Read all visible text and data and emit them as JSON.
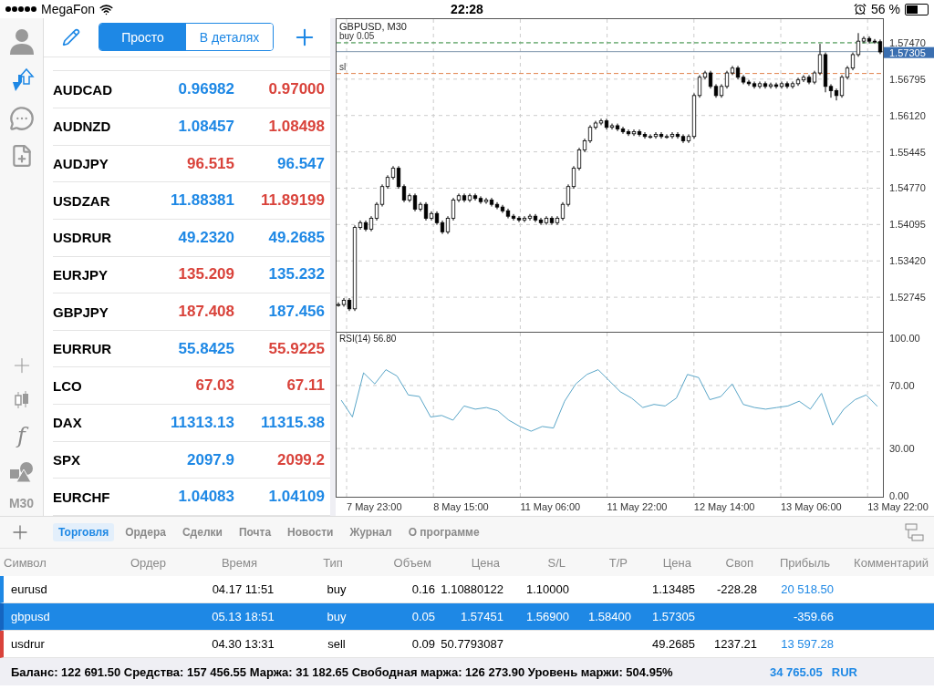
{
  "status_bar": {
    "carrier": "MegaFon",
    "time": "22:28",
    "battery": "56 %"
  },
  "sidebar": {
    "indicator_symbol": "f",
    "timeframe": "M30"
  },
  "quotes": {
    "modes": [
      {
        "label": "Просто",
        "selected": true
      },
      {
        "label": "В деталях",
        "selected": false
      }
    ],
    "rows": [
      {
        "symbol": "AUDCAD",
        "bid": {
          "value": "0.96982",
          "color": "#1e88e5"
        },
        "ask": {
          "value": "0.97000",
          "color": "#d9433b"
        }
      },
      {
        "symbol": "AUDNZD",
        "bid": {
          "value": "1.08457",
          "color": "#1e88e5"
        },
        "ask": {
          "value": "1.08498",
          "color": "#d9433b"
        }
      },
      {
        "symbol": "AUDJPY",
        "bid": {
          "value": "96.515",
          "color": "#d9433b"
        },
        "ask": {
          "value": "96.547",
          "color": "#1e88e5"
        }
      },
      {
        "symbol": "USDZAR",
        "bid": {
          "value": "11.88381",
          "color": "#1e88e5"
        },
        "ask": {
          "value": "11.89199",
          "color": "#d9433b"
        }
      },
      {
        "symbol": "USDRUR",
        "bid": {
          "value": "49.2320",
          "color": "#1e88e5"
        },
        "ask": {
          "value": "49.2685",
          "color": "#1e88e5"
        }
      },
      {
        "symbol": "EURJPY",
        "bid": {
          "value": "135.209",
          "color": "#d9433b"
        },
        "ask": {
          "value": "135.232",
          "color": "#1e88e5"
        }
      },
      {
        "symbol": "GBPJPY",
        "bid": {
          "value": "187.408",
          "color": "#d9433b"
        },
        "ask": {
          "value": "187.456",
          "color": "#1e88e5"
        }
      },
      {
        "symbol": "EURRUR",
        "bid": {
          "value": "55.8425",
          "color": "#1e88e5"
        },
        "ask": {
          "value": "55.9225",
          "color": "#d9433b"
        }
      },
      {
        "symbol": "LCO",
        "bid": {
          "value": "67.03",
          "color": "#d9433b"
        },
        "ask": {
          "value": "67.11",
          "color": "#d9433b"
        }
      },
      {
        "symbol": "DAX",
        "bid": {
          "value": "11313.13",
          "color": "#1e88e5"
        },
        "ask": {
          "value": "11315.38",
          "color": "#1e88e5"
        }
      },
      {
        "symbol": "SPX",
        "bid": {
          "value": "2097.9",
          "color": "#1e88e5"
        },
        "ask": {
          "value": "2099.2",
          "color": "#d9433b"
        }
      },
      {
        "symbol": "EURCHF",
        "bid": {
          "value": "1.04083",
          "color": "#1e88e5"
        },
        "ask": {
          "value": "1.04109",
          "color": "#1e88e5"
        }
      }
    ]
  },
  "chart": {
    "chart_data": {
      "type": "candlestick",
      "title": "GBPUSD, M30",
      "grid": true,
      "ylim": [
        1.52104,
        1.57892
      ],
      "yticks": [
        {
          "value": 1.5747,
          "label": "1.57470"
        },
        {
          "value": 1.56795,
          "label": "1.56795"
        },
        {
          "value": 1.5612,
          "label": "1.56120"
        },
        {
          "value": 1.55445,
          "label": "1.55445"
        },
        {
          "value": 1.5477,
          "label": "1.54770"
        },
        {
          "value": 1.54095,
          "label": "1.54095"
        },
        {
          "value": 1.5342,
          "label": "1.53420"
        },
        {
          "value": 1.52745,
          "label": "1.52745"
        }
      ],
      "ref_lines": [
        {
          "axis": "y",
          "value": 1.5747,
          "label": "buy 0.05",
          "color": "#3f9a4a"
        },
        {
          "axis": "y",
          "value": 1.57305,
          "label": "1.57305",
          "color": "#7f96ad"
        },
        {
          "axis": "y",
          "value": 1.569,
          "label": "sl",
          "color": "#e0804a"
        }
      ],
      "categories": [
        null,
        null,
        null,
        null,
        null,
        null,
        null,
        null,
        null,
        null,
        null,
        null,
        null,
        null,
        null,
        null,
        null,
        null,
        null,
        null,
        null,
        null,
        null,
        null,
        null,
        null,
        null,
        null,
        null,
        null,
        null,
        null,
        null,
        null,
        null,
        null,
        null,
        null,
        null,
        null,
        null,
        null,
        null,
        null,
        null,
        null,
        null,
        null,
        null,
        null,
        null,
        null,
        null,
        null,
        null,
        null,
        null,
        null,
        null,
        null,
        null,
        null,
        null,
        null,
        null,
        null,
        null,
        null,
        null,
        null,
        null,
        null,
        null,
        null,
        null,
        null,
        null,
        null,
        null,
        null,
        null,
        null,
        null,
        null,
        null,
        null,
        null,
        null,
        null,
        null,
        null,
        null,
        null,
        null,
        null,
        null,
        null,
        null,
        null,
        null
      ],
      "ohlc": [
        [
          1.5261,
          1.5265,
          1.5257,
          1.5261
        ],
        [
          1.5261,
          1.5273,
          1.5257,
          1.5269
        ],
        [
          1.5269,
          1.5273,
          1.5249,
          1.5253
        ],
        [
          1.5253,
          1.5408,
          1.5249,
          1.5404
        ],
        [
          1.5404,
          1.5417,
          1.54,
          1.5413
        ],
        [
          1.5413,
          1.5417,
          1.5397,
          1.5401
        ],
        [
          1.5401,
          1.5425,
          1.5397,
          1.5421
        ],
        [
          1.5421,
          1.5451,
          1.5417,
          1.5447
        ],
        [
          1.5447,
          1.5484,
          1.5443,
          1.548
        ],
        [
          1.548,
          1.5501,
          1.5476,
          1.5497
        ],
        [
          1.5497,
          1.5518,
          1.5493,
          1.5514
        ],
        [
          1.5514,
          1.5518,
          1.5476,
          1.548
        ],
        [
          1.548,
          1.5484,
          1.5451,
          1.5455
        ],
        [
          1.5455,
          1.5467,
          1.5451,
          1.5463
        ],
        [
          1.5463,
          1.5467,
          1.5434,
          1.5438
        ],
        [
          1.5438,
          1.5451,
          1.5434,
          1.5447
        ],
        [
          1.5447,
          1.5451,
          1.5417,
          1.5421
        ],
        [
          1.5421,
          1.5434,
          1.5417,
          1.543
        ],
        [
          1.543,
          1.5434,
          1.5409,
          1.5413
        ],
        [
          1.5413,
          1.5417,
          1.5392,
          1.5396
        ],
        [
          1.5396,
          1.5425,
          1.5392,
          1.5421
        ],
        [
          1.5421,
          1.5459,
          1.5417,
          1.5455
        ],
        [
          1.5455,
          1.5467,
          1.5451,
          1.5463
        ],
        [
          1.5463,
          1.5467,
          1.5451,
          1.5455
        ],
        [
          1.5455,
          1.5467,
          1.5451,
          1.5463
        ],
        [
          1.5463,
          1.5467,
          1.5454,
          1.5458
        ],
        [
          1.5458,
          1.5462,
          1.5448,
          1.5452
        ],
        [
          1.5452,
          1.5459,
          1.5448,
          1.5455
        ],
        [
          1.5455,
          1.5459,
          1.5443,
          1.5447
        ],
        [
          1.5447,
          1.5451,
          1.5438,
          1.5442
        ],
        [
          1.5442,
          1.5446,
          1.5431,
          1.5435
        ],
        [
          1.5435,
          1.5439,
          1.5421,
          1.5425
        ],
        [
          1.5425,
          1.5429,
          1.5417,
          1.5421
        ],
        [
          1.5421,
          1.5425,
          1.5414,
          1.5418
        ],
        [
          1.5418,
          1.5425,
          1.5414,
          1.5421
        ],
        [
          1.5421,
          1.5429,
          1.5417,
          1.5425
        ],
        [
          1.5425,
          1.5429,
          1.5414,
          1.5418
        ],
        [
          1.5418,
          1.5422,
          1.5409,
          1.5413
        ],
        [
          1.5413,
          1.5425,
          1.5409,
          1.5421
        ],
        [
          1.5421,
          1.5425,
          1.5409,
          1.5413
        ],
        [
          1.5413,
          1.5425,
          1.5409,
          1.5421
        ],
        [
          1.5421,
          1.5451,
          1.5417,
          1.5447
        ],
        [
          1.5447,
          1.5484,
          1.5443,
          1.548
        ],
        [
          1.548,
          1.5518,
          1.5476,
          1.5514
        ],
        [
          1.5514,
          1.5552,
          1.551,
          1.5548
        ],
        [
          1.5548,
          1.5569,
          1.5544,
          1.5565
        ],
        [
          1.5565,
          1.5594,
          1.5561,
          1.559
        ],
        [
          1.559,
          1.5602,
          1.5586,
          1.5598
        ],
        [
          1.5598,
          1.5606,
          1.5594,
          1.5602
        ],
        [
          1.5602,
          1.5606,
          1.5586,
          1.559
        ],
        [
          1.559,
          1.5597,
          1.5586,
          1.5593
        ],
        [
          1.5593,
          1.5597,
          1.5583,
          1.5587
        ],
        [
          1.5587,
          1.5591,
          1.5578,
          1.5582
        ],
        [
          1.5582,
          1.5586,
          1.5574,
          1.5578
        ],
        [
          1.5578,
          1.5586,
          1.5574,
          1.5582
        ],
        [
          1.5582,
          1.5586,
          1.5573,
          1.5577
        ],
        [
          1.5577,
          1.5581,
          1.5569,
          1.5573
        ],
        [
          1.5573,
          1.5577,
          1.5569,
          1.5573
        ],
        [
          1.5573,
          1.5581,
          1.5569,
          1.5577
        ],
        [
          1.5577,
          1.5581,
          1.5569,
          1.5573
        ],
        [
          1.5573,
          1.5577,
          1.5569,
          1.5573
        ],
        [
          1.5573,
          1.5581,
          1.5569,
          1.5577
        ],
        [
          1.5577,
          1.5581,
          1.5569,
          1.5573
        ],
        [
          1.5573,
          1.5577,
          1.5561,
          1.5565
        ],
        [
          1.5565,
          1.5577,
          1.5561,
          1.5573
        ],
        [
          1.5573,
          1.5653,
          1.5569,
          1.5649
        ],
        [
          1.5649,
          1.5687,
          1.5645,
          1.5683
        ],
        [
          1.5683,
          1.5695,
          1.5679,
          1.5691
        ],
        [
          1.5691,
          1.5695,
          1.5662,
          1.5666
        ],
        [
          1.5666,
          1.567,
          1.5645,
          1.5649
        ],
        [
          1.5649,
          1.567,
          1.5645,
          1.5666
        ],
        [
          1.5666,
          1.5695,
          1.5662,
          1.5691
        ],
        [
          1.5691,
          1.5704,
          1.5687,
          1.57
        ],
        [
          1.57,
          1.5704,
          1.5679,
          1.5683
        ],
        [
          1.5683,
          1.5687,
          1.567,
          1.5674
        ],
        [
          1.5674,
          1.5678,
          1.5667,
          1.5671
        ],
        [
          1.5671,
          1.5675,
          1.5662,
          1.5666
        ],
        [
          1.5666,
          1.5675,
          1.5662,
          1.5671
        ],
        [
          1.5671,
          1.5675,
          1.5662,
          1.5666
        ],
        [
          1.5666,
          1.5673,
          1.5662,
          1.5669
        ],
        [
          1.5669,
          1.5673,
          1.5662,
          1.5666
        ],
        [
          1.5666,
          1.5675,
          1.5662,
          1.5671
        ],
        [
          1.5671,
          1.5675,
          1.5662,
          1.5666
        ],
        [
          1.5666,
          1.5675,
          1.5662,
          1.5671
        ],
        [
          1.5671,
          1.5682,
          1.5667,
          1.5678
        ],
        [
          1.5678,
          1.5687,
          1.5674,
          1.5683
        ],
        [
          1.5683,
          1.5687,
          1.567,
          1.5674
        ],
        [
          1.5674,
          1.5695,
          1.567,
          1.5691
        ],
        [
          1.5691,
          1.5745,
          1.5687,
          1.5725
        ],
        [
          1.5725,
          1.5729,
          1.5655,
          1.5666
        ],
        [
          1.5666,
          1.567,
          1.5645,
          1.5658
        ],
        [
          1.5658,
          1.5662,
          1.564,
          1.5649
        ],
        [
          1.5649,
          1.5687,
          1.5645,
          1.5683
        ],
        [
          1.5683,
          1.5704,
          1.5679,
          1.57
        ],
        [
          1.57,
          1.5729,
          1.5696,
          1.5725
        ],
        [
          1.5725,
          1.5765,
          1.5721,
          1.575
        ],
        [
          1.575,
          1.5759,
          1.5746,
          1.5755
        ],
        [
          1.5755,
          1.5759,
          1.5746,
          1.575
        ],
        [
          1.575,
          1.5754,
          1.5745,
          1.5749
        ],
        [
          1.5749,
          1.5753,
          1.5726,
          1.573
        ]
      ]
    }
  },
  "rsi": {
    "time_labels": [
      "7 May 23:00",
      "8 May 15:00",
      "11 May 06:00",
      "11 May 22:00",
      "12 May 14:00",
      "13 May 06:00",
      "13 May 22:00"
    ],
    "chart_data": {
      "type": "line",
      "title": "RSI(14) 56.80",
      "grid": true,
      "ylim": [
        -0.6,
        103.8
      ],
      "yticks": [
        {
          "value": 100,
          "label": "100.00"
        },
        {
          "value": 70,
          "label": "70.00"
        },
        {
          "value": 30,
          "label": "30.00"
        },
        {
          "value": 0,
          "label": "0.00"
        }
      ],
      "categories": [
        null,
        null,
        null,
        null,
        null,
        null,
        null,
        null,
        null,
        null,
        null,
        null,
        null,
        null,
        null,
        null,
        null,
        null,
        null,
        null,
        null,
        null,
        null,
        null,
        null,
        null,
        null,
        null,
        null,
        null,
        null,
        null,
        null,
        null,
        null,
        null,
        null,
        null,
        null,
        null,
        null,
        null,
        null,
        null,
        null,
        null,
        null,
        null,
        null
      ],
      "series": [
        {
          "color": "#5aa6c8",
          "values": [
            60.7,
            50,
            78,
            71,
            80,
            76,
            64,
            63,
            50,
            51,
            48,
            57,
            55,
            56,
            54,
            48,
            44,
            41,
            44,
            43,
            60,
            71,
            77,
            80,
            73,
            66,
            62,
            56,
            58,
            57,
            62,
            77,
            75,
            61,
            63,
            71,
            58,
            56,
            55,
            56,
            57,
            60,
            55,
            65,
            45,
            55,
            61,
            64,
            56.8
          ]
        }
      ]
    }
  },
  "terminal": {
    "tabs": [
      {
        "label": "Торговля",
        "selected": true
      },
      {
        "label": "Ордера",
        "selected": false
      },
      {
        "label": "Сделки",
        "selected": false
      },
      {
        "label": "Почта",
        "selected": false
      },
      {
        "label": "Новости",
        "selected": false
      },
      {
        "label": "Журнал",
        "selected": false
      },
      {
        "label": "О программе",
        "selected": false
      }
    ],
    "columns": [
      "Символ",
      "Ордер",
      "Время",
      "Тип",
      "Объем",
      "Цена",
      "S/L",
      "T/P",
      "Цена",
      "Своп",
      "Прибыль",
      "Комментарий"
    ],
    "rows": [
      {
        "kind": "buy",
        "selected": false,
        "symbol": "eurusd",
        "time": "04.17 11:51",
        "type": "buy",
        "volume": "0.16",
        "open_price": "1.10880122",
        "sl": "1.10000",
        "price": "1.13485",
        "swap": "-228.28",
        "profit": {
          "value": "20 518.50",
          "color": "#1e88e5"
        }
      },
      {
        "kind": "buy",
        "selected": true,
        "symbol": "gbpusd",
        "time": "05.13 18:51",
        "type": "buy",
        "volume": "0.05",
        "open_price": "1.57451",
        "sl": "1.56900",
        "tp": "1.58400",
        "price": "1.57305",
        "profit": {
          "value": "-359.66"
        }
      },
      {
        "kind": "sell",
        "selected": false,
        "symbol": "usdrur",
        "time": "04.30 13:31",
        "type": "sell",
        "volume": "0.09",
        "open_price": "50.7793087",
        "price": "49.2685",
        "swap": "1237.21",
        "profit": {
          "value": "13 597.28",
          "color": "#1e88e5"
        }
      }
    ],
    "summary": "Баланс: 122 691.50 Средства: 157 456.55 Маржа: 31 182.65 Свободная маржа: 126 273.90 Уровень маржи: 504.95%",
    "total": "34 765.05",
    "currency": "RUR"
  }
}
